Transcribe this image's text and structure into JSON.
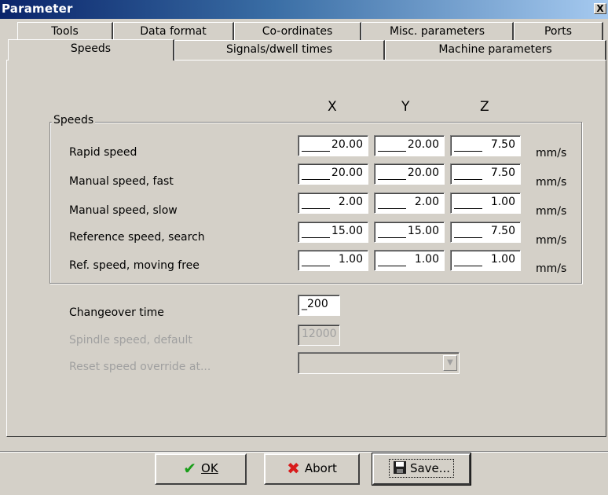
{
  "window": {
    "title": "Parameter",
    "close_glyph": "X"
  },
  "tabs_back": [
    "Tools",
    "Data format",
    "Co-ordinates",
    "Misc. parameters",
    "Ports"
  ],
  "tabs_front": [
    "Speeds",
    "Signals/dwell times",
    "Machine parameters"
  ],
  "active_tab": "Speeds",
  "columns": [
    "X",
    "Y",
    "Z"
  ],
  "speeds_group": {
    "title": "Speeds",
    "unit": "mm/s",
    "rows": [
      {
        "label": "Rapid speed",
        "x": "20.00",
        "y": "20.00",
        "z": "7.50"
      },
      {
        "label": "Manual speed, fast",
        "x": "20.00",
        "y": "20.00",
        "z": "7.50"
      },
      {
        "label": "Manual speed, slow",
        "x": "2.00",
        "y": "2.00",
        "z": "1.00"
      },
      {
        "label": "Reference speed, search",
        "x": "15.00",
        "y": "15.00",
        "z": "7.50"
      },
      {
        "label": "Ref. speed, moving free",
        "x": "1.00",
        "y": "1.00",
        "z": "1.00"
      }
    ]
  },
  "changeover": {
    "label": "Changeover time",
    "value": "_200"
  },
  "spindle": {
    "label": "Spindle speed, default",
    "value": "12000"
  },
  "reset_override": {
    "label": "Reset speed override at...",
    "value": ""
  },
  "buttons": {
    "ok": "OK",
    "abort": "Abort",
    "save": "Save..."
  },
  "colors": {
    "ok_icon": "#1a9e1a",
    "abort_icon": "#d81b1b",
    "title_bar": "#0a246a"
  },
  "icons": {
    "ok": "checkmark-icon",
    "abort": "x-icon",
    "save": "floppy-disk-icon"
  }
}
